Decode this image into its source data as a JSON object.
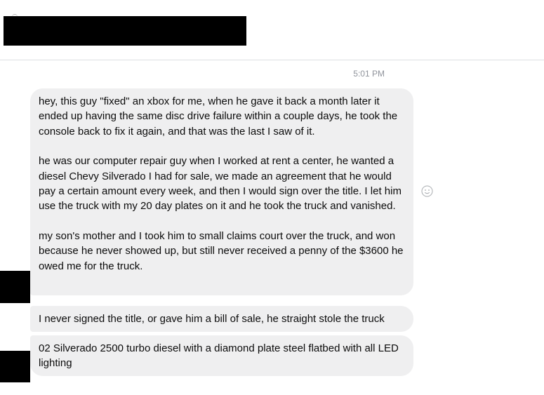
{
  "conversation": {
    "timestamp": "5:01 PM",
    "messages": [
      {
        "paragraphs": [
          "hey, this guy \"fixed\" an xbox for me, when he gave it back a month later it ended up having the same disc drive failure within a couple days, he took the console back to fix it again, and that was the last I saw of it.",
          "he was our computer repair guy when I worked at rent a center, he wanted a diesel Chevy Silverado I had for sale, we made an agreement that he would pay a certain amount every week, and then I would sign over the title. I let him use the truck with my 20 day plates on it and he took the truck and vanished.",
          "my son's mother and I took him to small claims court over the truck, and won because he never showed up, but still never received a penny of the $3600 he owed me for the truck."
        ]
      },
      {
        "paragraphs": [
          "I never signed the title, or gave him a bill of sale, he straight stole the truck"
        ]
      },
      {
        "paragraphs": [
          "02 Silverado 2500 turbo diesel with a diamond plate steel flatbed with all LED lighting"
        ]
      }
    ]
  },
  "icons": {
    "emoji": "smiley-face-icon"
  },
  "colors": {
    "bubble_background": "#efeff0",
    "timestamp_text": "#90949c",
    "redaction": "#000000",
    "divider": "#dddfe2"
  }
}
